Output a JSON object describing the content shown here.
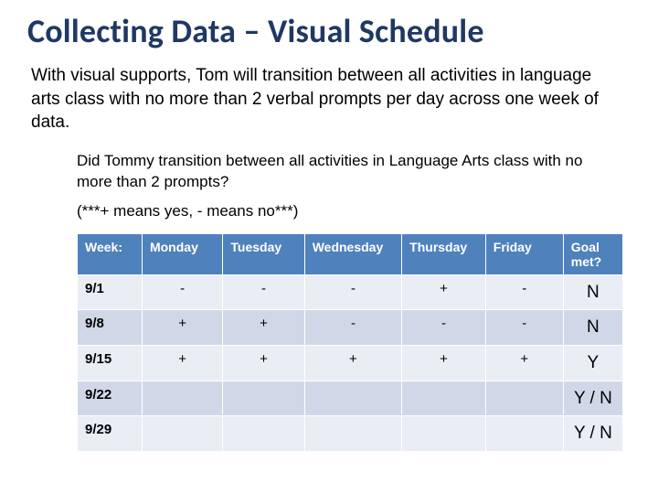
{
  "title": "Collecting Data – Visual Schedule",
  "goal_text": "With visual supports, Tom will transition between all activities in language arts class with no more than 2 verbal prompts per day across one week of data.",
  "question_text": "Did Tommy transition between all activities in Language Arts class with no more than 2 prompts?",
  "legend_text": "(***+ means yes, - means no***)",
  "chart_data": {
    "type": "table",
    "headers": {
      "week": "Week:",
      "mon": "Monday",
      "tue": "Tuesday",
      "wed": "Wednesday",
      "thu": "Thursday",
      "fri": "Friday",
      "goal": "Goal met?"
    },
    "rows": [
      {
        "week": "9/1",
        "mon": "-",
        "tue": "-",
        "wed": "-",
        "thu": "+",
        "fri": "-",
        "goal": "N"
      },
      {
        "week": "9/8",
        "mon": "+",
        "tue": "+",
        "wed": "-",
        "thu": "-",
        "fri": "-",
        "goal": "N"
      },
      {
        "week": "9/15",
        "mon": "+",
        "tue": "+",
        "wed": "+",
        "thu": "+",
        "fri": "+",
        "goal": "Y"
      },
      {
        "week": "9/22",
        "mon": "",
        "tue": "",
        "wed": "",
        "thu": "",
        "fri": "",
        "goal": "Y / N"
      },
      {
        "week": "9/29",
        "mon": "",
        "tue": "",
        "wed": "",
        "thu": "",
        "fri": "",
        "goal": "Y / N"
      }
    ]
  }
}
